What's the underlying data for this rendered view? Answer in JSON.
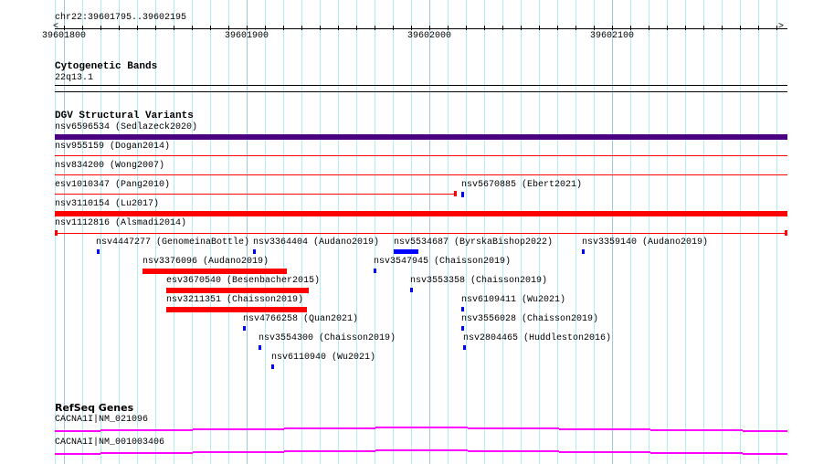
{
  "location": "chr22:39601795..39602195",
  "view": {
    "start": 39601795,
    "end": 39602195
  },
  "ruler": {
    "labels": [
      "39601800",
      "39601900",
      "39602000",
      "39602100"
    ]
  },
  "colors": {
    "grid": "#aeeef0",
    "grid_major": "#9cc8ea",
    "purple": "#4b0082",
    "red": "#ff0000",
    "blue": "#0000ff",
    "gene": "#ff00ff"
  },
  "cytoband": {
    "title": "Cytogenetic Bands",
    "band": "22q13.1"
  },
  "dgv": {
    "title": "DGV Structural Variants",
    "full_rows": [
      {
        "label": "nsv6596534 (Sedlazeck2020)",
        "style": "bar",
        "color": "purple"
      },
      {
        "label": "nsv955159 (Dogan2014)",
        "style": "line",
        "color": "red"
      },
      {
        "label": "nsv834200 (Wong2007)",
        "style": "line",
        "color": "red"
      },
      {
        "label": "esv1010347 (Pang2010)",
        "style": "line-end-left",
        "color": "red"
      },
      {
        "label": "nsv3110154 (Lu2017)",
        "style": "bar",
        "color": "red"
      },
      {
        "label": "nsv1112816 (Alsmadi2014)",
        "style": "line-both-ends",
        "color": "red"
      }
    ],
    "features": [
      {
        "label": "nsv5670885 (Ebert2021)",
        "start": 39602017.5,
        "end": 39602019,
        "color": "blue"
      },
      {
        "label": "nsv4447277 (GenomeinaBottle)",
        "start": 39601818,
        "end": 39601819.5,
        "color": "blue"
      },
      {
        "label": "nsv3364404 (Audano2019)",
        "start": 39601903.5,
        "end": 39601905,
        "color": "blue"
      },
      {
        "label": "nsv5534687 (ByrskaBishop2022)",
        "start": 39601980.5,
        "end": 39601994,
        "color": "blue"
      },
      {
        "label": "nsv3359140 (Audano2019)",
        "start": 39602083.5,
        "end": 39602085,
        "color": "blue"
      },
      {
        "label": "nsv3376096 (Audano2019)",
        "start": 39601843,
        "end": 39601922,
        "color": "red"
      },
      {
        "label": "nsv3547945 (Chaisson2019)",
        "start": 39601969.5,
        "end": 39601971,
        "color": "blue"
      },
      {
        "label": "esv3670540 (Besenbacher2015)",
        "start": 39601856,
        "end": 39601934,
        "color": "red"
      },
      {
        "label": "nsv3553358 (Chaisson2019)",
        "start": 39601989.5,
        "end": 39601991,
        "color": "blue"
      },
      {
        "label": "nsv3211351 (Chaisson2019)",
        "start": 39601856,
        "end": 39601933,
        "color": "red"
      },
      {
        "label": "nsv6109411 (Wu2021)",
        "start": 39602017.5,
        "end": 39602019,
        "color": "blue"
      },
      {
        "label": "nsv4766258 (Quan2021)",
        "start": 39601898,
        "end": 39601899.5,
        "color": "blue"
      },
      {
        "label": "nsv3556028 (Chaisson2019)",
        "start": 39602017.5,
        "end": 39602019,
        "color": "blue"
      },
      {
        "label": "nsv3554300 (Chaisson2019)",
        "start": 39601906.5,
        "end": 39601908,
        "color": "blue"
      },
      {
        "label": "nsv2804465 (Huddleston2016)",
        "start": 39602018.5,
        "end": 39602020,
        "color": "blue"
      },
      {
        "label": "nsv6110940 (Wu2021)",
        "start": 39601913.5,
        "end": 39601915,
        "color": "blue"
      }
    ]
  },
  "refseq": {
    "title": "RefSeq Genes",
    "genes": [
      {
        "label": "CACNA1I|NM_021096"
      },
      {
        "label": "CACNA1I|NM_001003406"
      }
    ]
  }
}
